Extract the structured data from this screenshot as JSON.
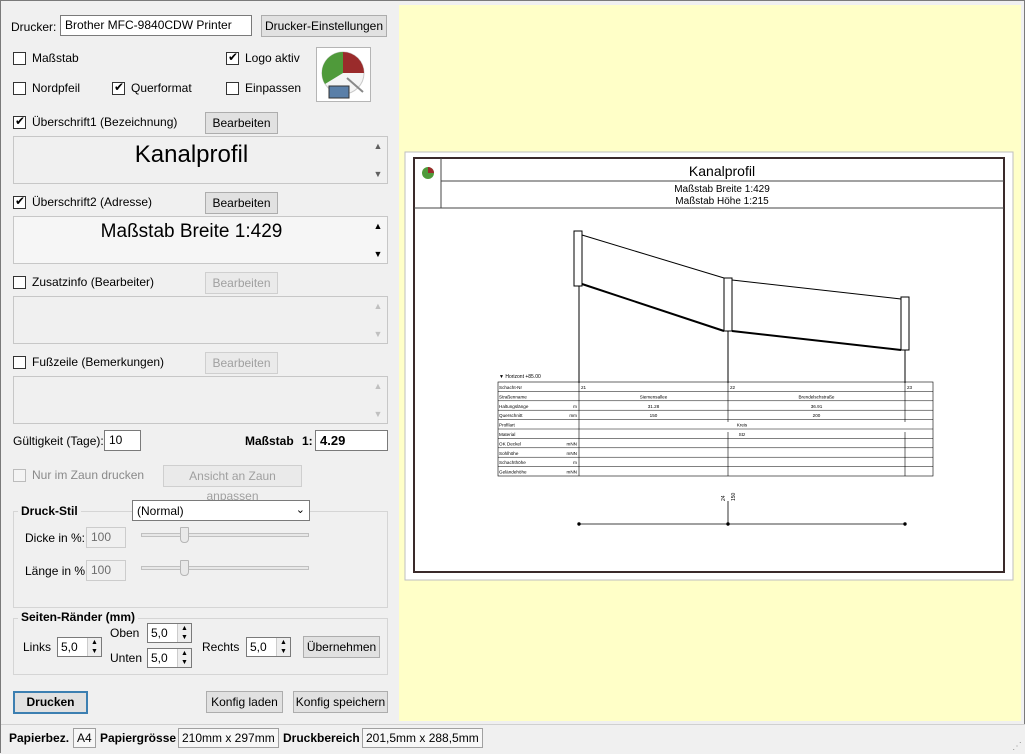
{
  "printer": {
    "label": "Drucker:",
    "value": "Brother MFC-9840CDW Printer",
    "settings_button": "Drucker-Einstellungen"
  },
  "options": {
    "massstab": {
      "label": "Maßstab",
      "checked": false
    },
    "logo": {
      "label": "Logo aktiv",
      "checked": true
    },
    "nordpfeil": {
      "label": "Nordpfeil",
      "checked": false
    },
    "querformat": {
      "label": "Querformat",
      "checked": true
    },
    "einpassen": {
      "label": "Einpassen",
      "checked": false
    }
  },
  "heading1": {
    "label": "Überschrift1 (Bezeichnung)",
    "checked": true,
    "edit_button": "Bearbeiten",
    "text": "Kanalprofil"
  },
  "heading2": {
    "label": "Überschrift2 (Adresse)",
    "checked": true,
    "edit_button": "Bearbeiten",
    "text": "Maßstab Breite 1:429"
  },
  "zusatzinfo": {
    "label": "Zusatzinfo (Bearbeiter)",
    "checked": false,
    "edit_button": "Bearbeiten",
    "text": ""
  },
  "fusszeile": {
    "label": "Fußzeile (Bemerkungen)",
    "checked": false,
    "edit_button": "Bearbeiten",
    "text": ""
  },
  "validity": {
    "label": "Gültigkeit (Tage):",
    "value": "10"
  },
  "scale": {
    "label": "Maßstab",
    "prefix": "1:",
    "value": "4.29"
  },
  "fence": {
    "only_label": "Nur im Zaun drucken",
    "fit_button": "Ansicht an Zaun anpassen"
  },
  "print_style": {
    "title": "Druck-Stil",
    "selected": "(Normal)",
    "thickness_label": "Dicke in %:",
    "thickness_value": "100",
    "length_label": "Länge in %:",
    "length_value": "100"
  },
  "margins": {
    "title": "Seiten-Ränder (mm)",
    "left_label": "Links",
    "left_value": "5,0",
    "top_label": "Oben",
    "top_value": "5,0",
    "bottom_label": "Unten",
    "bottom_value": "5,0",
    "right_label": "Rechts",
    "right_value": "5,0",
    "apply_button": "Übernehmen"
  },
  "actions": {
    "print": "Drucken",
    "load": "Konfig laden",
    "save": "Konfig speichern"
  },
  "statusbar": {
    "paper_label": "Papierbez.",
    "paper_value": "A4",
    "size_label": "Papiergrösse",
    "size_value": "210mm x 297mm",
    "area_label": "Druckbereich",
    "area_value": "201,5mm x 288,5mm"
  },
  "preview": {
    "title": "Kanalprofil",
    "sub1": "Maßstab Breite 1:429",
    "sub2": "Maßstab Höhe 1:215",
    "horizon": "▼ Horizont +85.00",
    "table_labels": [
      "Schacht-Nr",
      "Straßenname",
      "Haltungslänge",
      "Querschnitt",
      "Profilart",
      "Material",
      "OK Deckel",
      "Sohlhöhe",
      "Schachthöhe",
      "Geländehöhe"
    ],
    "table_units": [
      "",
      "",
      "m",
      "mm",
      "",
      "",
      "mNN",
      "mNN",
      "m",
      "mNN"
    ],
    "schacht": [
      "21",
      "22",
      "23"
    ],
    "strassen": [
      "Siemensallee",
      "Brendelschstraße"
    ],
    "laengen": [
      "31.28",
      "36.91"
    ],
    "querschnitt": [
      "150",
      "200"
    ],
    "profilart": "Kreis",
    "material": "Stz",
    "dim_label": "24",
    "dim_label2": "150"
  },
  "colors": {
    "preview_bg": "#ffffc8",
    "frame": "#3a2a2a"
  }
}
